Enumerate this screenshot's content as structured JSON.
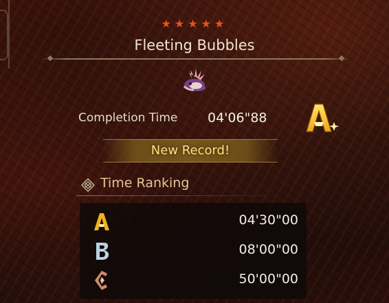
{
  "quest": {
    "stars": "★★★★★",
    "title": "Fleeting Bubbles",
    "monster_icon": "bubble-fox-monster-icon"
  },
  "result": {
    "completion_label": "Completion Time",
    "completion_time": "04'06\"88",
    "grade": "A",
    "record_label": "New Record!"
  },
  "ranking": {
    "title": "Time Ranking",
    "rows": [
      {
        "grade": "A",
        "time": "04'30\"00",
        "color": "#f2b21c"
      },
      {
        "grade": "B",
        "time": "08'00\"00",
        "color": "#b9d2e2"
      },
      {
        "grade": "C",
        "time": "50'00\"00",
        "color": "#d28a6c"
      }
    ]
  },
  "colors": {
    "stars": "#e8521e",
    "record_text": "#ffe07a",
    "ranking_title": "#e3c699"
  }
}
